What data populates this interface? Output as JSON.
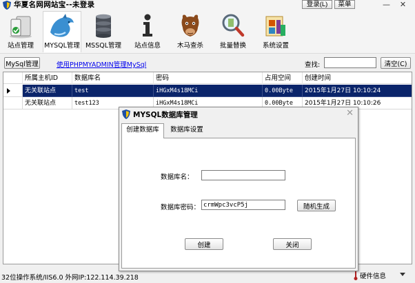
{
  "window": {
    "title": "华夏名网网站宝--未登录",
    "login_button": "登录(L)",
    "menu_button": "菜单",
    "minimize": "—",
    "close": "✕"
  },
  "toolbar": {
    "items": [
      {
        "label": "站点管理",
        "icon": "server-icon"
      },
      {
        "label": "MYSQL管理",
        "icon": "dolphin-icon"
      },
      {
        "label": "MSSQL管理",
        "icon": "database-icon"
      },
      {
        "label": "站点信息",
        "icon": "info-icon"
      },
      {
        "label": "木马查杀",
        "icon": "horse-icon"
      },
      {
        "label": "批量替换",
        "icon": "magnifier-icon"
      },
      {
        "label": "系统设置",
        "icon": "settings-icon"
      }
    ]
  },
  "subbar": {
    "mysql_button": "MySql管理",
    "link": "使用PHPMYADMIN管理MySql",
    "search_label": "查找:",
    "search_value": "",
    "clear_button": "清空(C)"
  },
  "grid": {
    "columns": [
      "所属主机ID",
      "数据库名",
      "密码",
      "占用空间",
      "创建时间"
    ],
    "rows": [
      {
        "host": "无关联站点",
        "name": "test",
        "password": "iHGxM4s18MCi",
        "size": "0.00Byte",
        "created": "2015年1月27日 10:10:24",
        "selected": true
      },
      {
        "host": "无关联站点",
        "name": "test123",
        "password": "iHGxM4s18MCi",
        "size": "0.00Byte",
        "created": "2015年1月27日 10:10:26",
        "selected": false
      }
    ]
  },
  "status": {
    "text": "32位操作系统/IIS6.0 外网IP:122.114.39.218",
    "hardware": "硬件信息"
  },
  "dialog": {
    "title": "MYSQL数据库管理",
    "close": "✕",
    "tabs": [
      "创建数据库",
      "数据库设置"
    ],
    "db_name_label": "数据库名：",
    "db_name_value": "",
    "db_password_label": "数据库密码：",
    "db_password_value": "crmWpc3vcP5j",
    "random_button": "随机生成",
    "create_button": "创建",
    "close_button": "关闭"
  },
  "colors": {
    "selected_row": "#0a246a",
    "link": "#0000ee"
  }
}
